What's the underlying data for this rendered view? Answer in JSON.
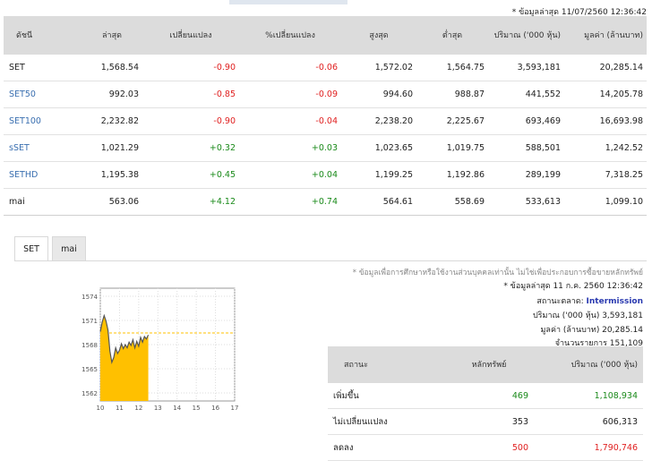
{
  "top_note": "* ข้อมูลล่าสุด 11/07/2560 12:36:42",
  "table": {
    "headers": [
      "ดัชนี",
      "ล่าสุด",
      "เปลี่ยนแปลง",
      "%เปลี่ยนแปลง",
      "สูงสุด",
      "ต่ำสุด",
      "ปริมาณ ('000 หุ้น)",
      "มูลค่า (ล้านบาท)"
    ],
    "rows": [
      {
        "name": "SET",
        "last": "1,568.54",
        "chg": "-0.90",
        "pct": "-0.06",
        "high": "1,572.02",
        "low": "1,564.75",
        "vol": "3,593,181",
        "val": "20,285.14"
      },
      {
        "name": "SET50",
        "last": "992.03",
        "chg": "-0.85",
        "pct": "-0.09",
        "high": "994.60",
        "low": "988.87",
        "vol": "441,552",
        "val": "14,205.78"
      },
      {
        "name": "SET100",
        "last": "2,232.82",
        "chg": "-0.90",
        "pct": "-0.04",
        "high": "2,238.20",
        "low": "2,225.67",
        "vol": "693,469",
        "val": "16,693.98"
      },
      {
        "name": "sSET",
        "last": "1,021.29",
        "chg": "+0.32",
        "pct": "+0.03",
        "high": "1,023.65",
        "low": "1,019.75",
        "vol": "588,501",
        "val": "1,242.52"
      },
      {
        "name": "SETHD",
        "last": "1,195.38",
        "chg": "+0.45",
        "pct": "+0.04",
        "high": "1,199.25",
        "low": "1,192.86",
        "vol": "289,199",
        "val": "7,318.25"
      },
      {
        "name": "mai",
        "last": "563.06",
        "chg": "+4.12",
        "pct": "+0.74",
        "high": "564.61",
        "low": "558.69",
        "vol": "533,613",
        "val": "1,099.10"
      }
    ]
  },
  "tabs": [
    "SET",
    "mai"
  ],
  "disclaimer": "* ข้อมูลเพื่อการศึกษาหรือใช้งานส่วนบุคคลเท่านั้น ไม่ใช่เพื่อประกอบการซื้อขายหลักทรัพย์",
  "info": {
    "updated": "* ข้อมูลล่าสุด 11 ก.ค. 2560 12:36:42",
    "market_status_label": "สถานะตลาด:",
    "market_status_value": "Intermission",
    "volume_line": "ปริมาณ ('000 หุ้น)  3,593,181",
    "value_line": "มูลค่า (ล้านบาท)  20,285.14",
    "deals_line": "จำนวนรายการ  151,109"
  },
  "summary": {
    "headers": [
      "สถานะ",
      "หลักทรัพย์",
      "ปริมาณ ('000 หุ้น)"
    ],
    "rows": [
      {
        "status": "เพิ่มขึ้น",
        "count": "469",
        "volume": "1,108,934"
      },
      {
        "status": "ไม่เปลี่ยนแปลง",
        "count": "353",
        "volume": "606,313"
      },
      {
        "status": "ลดลง",
        "count": "500",
        "volume": "1,790,746"
      }
    ]
  },
  "chart_data": {
    "type": "area",
    "x_ticks": [
      "10",
      "11",
      "12",
      "13",
      "14",
      "15",
      "16",
      "17"
    ],
    "y_ticks": [
      "1562",
      "1565",
      "1568",
      "1571",
      "1574"
    ],
    "ylim": [
      1561,
      1575
    ],
    "xlim": [
      10,
      17
    ],
    "reference_value": 1569.44,
    "x": [
      10.0,
      10.1,
      10.2,
      10.3,
      10.4,
      10.5,
      10.6,
      10.7,
      10.8,
      10.9,
      11.0,
      11.1,
      11.2,
      11.3,
      11.4,
      11.5,
      11.6,
      11.7,
      11.8,
      11.9,
      12.0,
      12.1,
      12.2,
      12.3,
      12.4,
      12.5
    ],
    "y": [
      1569.6,
      1570.8,
      1571.6,
      1570.9,
      1569.8,
      1567.2,
      1565.8,
      1566.4,
      1567.6,
      1566.9,
      1567.3,
      1568.1,
      1567.5,
      1568.0,
      1567.6,
      1568.3,
      1567.9,
      1568.6,
      1567.6,
      1568.4,
      1567.8,
      1568.9,
      1568.3,
      1569.0,
      1568.7,
      1569.2
    ],
    "colors": {
      "fill": "#ffc000",
      "line": "#555555",
      "reference": "#ffc000",
      "frame": "#999999",
      "grid": "#dddddd"
    }
  }
}
